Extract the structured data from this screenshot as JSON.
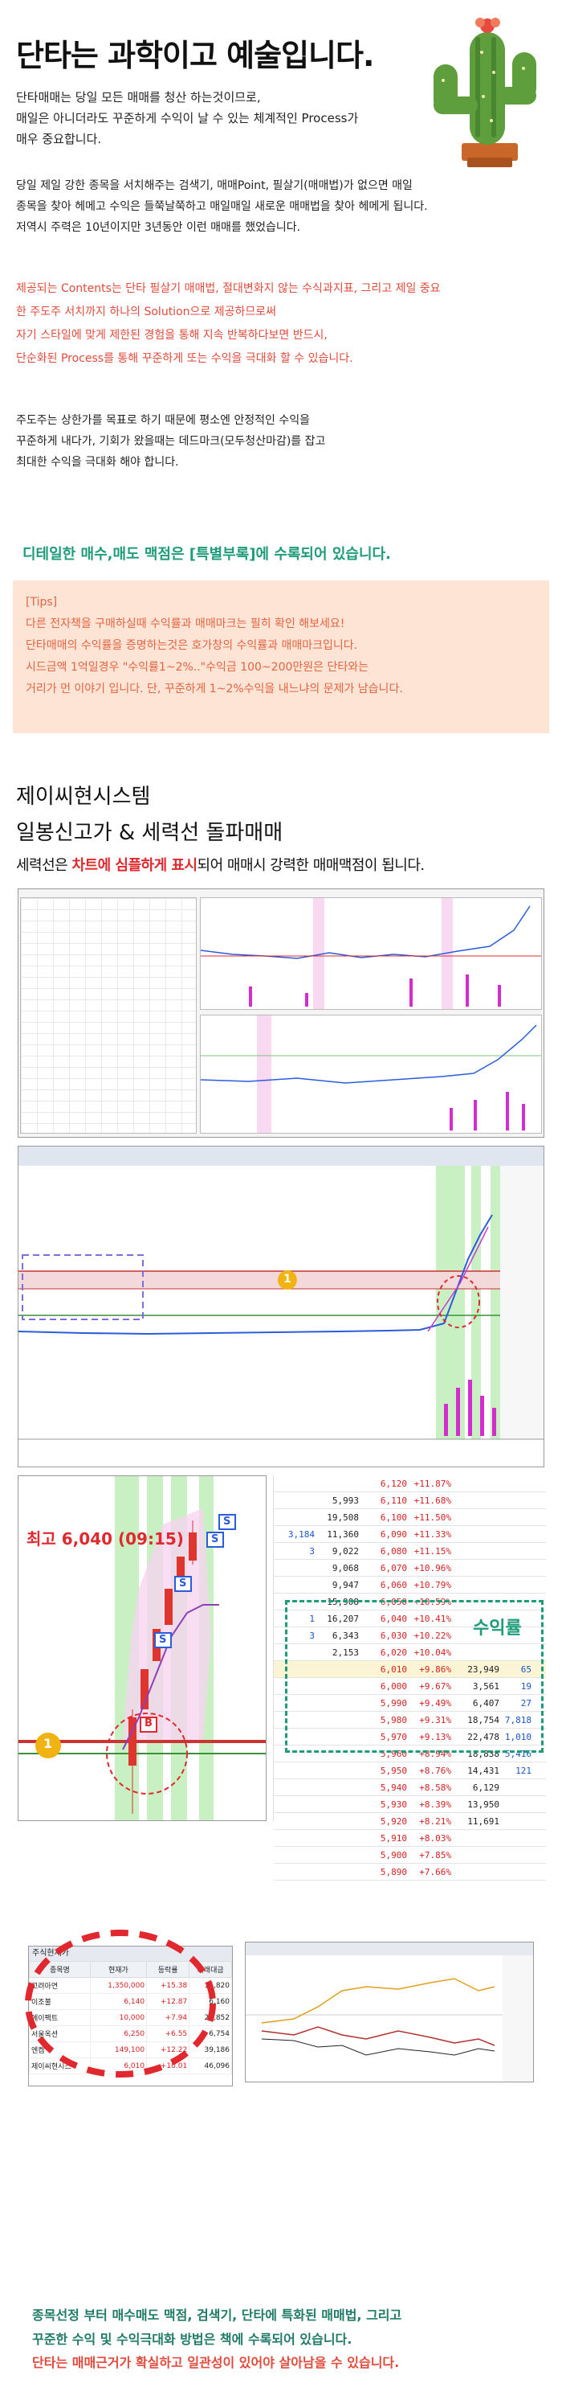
{
  "header": {
    "title": "단타는 과학이고 예술입니다.",
    "intro": [
      "단타매매는 당일 모든 매매를 청산 하는것이므로,",
      "매일은 아니더라도 꾸준하게 수익이 날 수 있는 체계적인 Process가",
      "매우 중요합니다."
    ]
  },
  "paragraphs": {
    "p2": [
      "당일 제일 강한 종목을 서치해주는 검색기, 매매Point, 필살기(매매법)가 없으면 매일",
      "종목을 찾아 헤메고 수익은 들쭉날쭉하고 매일매일 새로운 매매법을 찾아 헤메게 됩니다.",
      "저역시 주력은 10년이지만 3년동안 이런 매매를 했었습니다."
    ],
    "p3": [
      "제공되는 Contents는 단타 필살기 매매법, 절대변화지 않는 수식과지표, 그리고 제일 중요",
      "한 주도주 서치까지 하나의 Solution으로 제공하므로써",
      "자기 스타일에 맞게 제한된 경험을 통해 지속 반복하다보면 반드시,",
      "단순화된 Process를 통해 꾸준하게 또는 수익을 극대화 할 수 있습니다."
    ],
    "p4": [
      "주도주는 상한가를 목표로 하기 때문에 평소엔 안정적인 수익을",
      "꾸준하게 내다가, 기회가 왔을때는 데드마크(모두청산마감)를 잡고",
      "최대한 수익을 극대화 해야 합니다."
    ]
  },
  "green_note": "디테일한 매수,매도 맥점은 [특별부록]에 수록되어 있습니다.",
  "tips": {
    "heading": "[Tips]",
    "lines": [
      "다른 전자책을 구매하실때 수익률과 매매마크는 필히 확인 해보세요!",
      "단타매매의 수익률을 증명하는것은 호가창의 수익률과 매매마크입니다.",
      "시드금액 1억일경우 \"수익률1~2%..\"수익금 100~200만원은 단타와는",
      "거리가 먼 이야기 입니다. 단, 꾸준하게 1~2%수익을 내느냐의 문제가 남습니다."
    ]
  },
  "system": {
    "title": "제이씨현시스템",
    "subtitle": "일봉신고가 & 세력선 돌파매매",
    "desc_pre": "세력선은 ",
    "desc_bold": "차트에 심플하게 표시",
    "desc_post": "되어 매매시 강력한 매매맥점이 됩니다."
  },
  "chart_callout": {
    "high_label": "최고 6,040 (09:15)",
    "marker_number": "1",
    "marker_b": "B",
    "marker_s": "S"
  },
  "orderbook": {
    "yield_label": "수익률",
    "rows": [
      {
        "a": "",
        "b": "",
        "c": "6,120",
        "d": "+11.87%",
        "e": "",
        "f": ""
      },
      {
        "a": "",
        "b": "5,993",
        "c": "6,110",
        "d": "+11.68%",
        "e": "",
        "f": ""
      },
      {
        "a": "",
        "b": "19,508",
        "c": "6,100",
        "d": "+11.50%",
        "e": "",
        "f": ""
      },
      {
        "a": "3,184",
        "b": "11,360",
        "c": "6,090",
        "d": "+11.33%",
        "e": "",
        "f": ""
      },
      {
        "a": "3",
        "b": "9,022",
        "c": "6,080",
        "d": "+11.15%",
        "e": "",
        "f": ""
      },
      {
        "a": "",
        "b": "9,068",
        "c": "6,070",
        "d": "+10.96%",
        "e": "",
        "f": ""
      },
      {
        "a": "",
        "b": "9,947",
        "c": "6,060",
        "d": "+10.79%",
        "e": "",
        "f": ""
      },
      {
        "a": "",
        "b": "15,908",
        "c": "6,050",
        "d": "+10.59%",
        "e": "",
        "f": ""
      },
      {
        "a": "1",
        "b": "16,207",
        "c": "6,040",
        "d": "+10.41%",
        "e": "",
        "f": ""
      },
      {
        "a": "3",
        "b": "6,343",
        "c": "6,030",
        "d": "+10.22%",
        "e": "",
        "f": ""
      },
      {
        "a": "",
        "b": "2,153",
        "c": "6,020",
        "d": "+10.04%",
        "e": "",
        "f": ""
      },
      {
        "a": "",
        "b": "",
        "c": "6,010",
        "d": "+9.86%",
        "e": "23,949",
        "f": "65"
      },
      {
        "a": "",
        "b": "",
        "c": "6,000",
        "d": "+9.67%",
        "e": "3,561",
        "f": "19"
      },
      {
        "a": "",
        "b": "",
        "c": "5,990",
        "d": "+9.49%",
        "e": "6,407",
        "f": "27"
      },
      {
        "a": "",
        "b": "",
        "c": "5,980",
        "d": "+9.31%",
        "e": "18,754",
        "f": "7,818"
      },
      {
        "a": "",
        "b": "",
        "c": "5,970",
        "d": "+9.13%",
        "e": "22,478",
        "f": "1,010"
      },
      {
        "a": "",
        "b": "",
        "c": "5,960",
        "d": "+8.94%",
        "e": "18,838",
        "f": "5,416"
      },
      {
        "a": "",
        "b": "",
        "c": "5,950",
        "d": "+8.76%",
        "e": "14,431",
        "f": "121"
      },
      {
        "a": "",
        "b": "",
        "c": "5,940",
        "d": "+8.58%",
        "e": "6,129",
        "f": ""
      },
      {
        "a": "",
        "b": "",
        "c": "5,930",
        "d": "+8.39%",
        "e": "13,950",
        "f": ""
      },
      {
        "a": "",
        "b": "",
        "c": "5,920",
        "d": "+8.21%",
        "e": "11,691",
        "f": ""
      },
      {
        "a": "",
        "b": "",
        "c": "5,910",
        "d": "+8.03%",
        "e": "",
        "f": ""
      },
      {
        "a": "",
        "b": "",
        "c": "5,900",
        "d": "+7.85%",
        "e": "",
        "f": ""
      },
      {
        "a": "",
        "b": "",
        "c": "5,890",
        "d": "+7.66%",
        "e": "",
        "f": ""
      }
    ]
  },
  "portfolio": {
    "window_title": "주식현재가",
    "headers": [
      "종목명",
      "현재가",
      "등락률",
      "거래대금"
    ],
    "rows": [
      [
        "고려아연",
        "1,350,000",
        "+15.38",
        "15,820"
      ],
      [
        "이조불",
        "6,140",
        "+12.87",
        "6,160"
      ],
      [
        "에이팩트",
        "10,000",
        "+7.94",
        "21,852"
      ],
      [
        "서울옥션",
        "6,250",
        "+6.55",
        "6,754"
      ],
      [
        "엔켐",
        "149,100",
        "+12.22",
        "39,186"
      ],
      [
        "제이씨현시스",
        "6,010",
        "+10.01",
        "46,096"
      ]
    ]
  },
  "footer": {
    "line1": "종목선정 부터 매수매도 맥점, 검색기, 단타에 특화된 매매법, 그리고",
    "line2": "꾸준한 수익 및 수익극대화 방법은 책에 수록되어 있습니다.",
    "line3": "단타는 매매근거가 확실하고 일관성이 있어야 살아남을 수 있습니다."
  },
  "colors": {
    "accent_red": "#e0282e",
    "accent_green": "#1e9c7a",
    "tips_bg": "#fde4d4"
  }
}
